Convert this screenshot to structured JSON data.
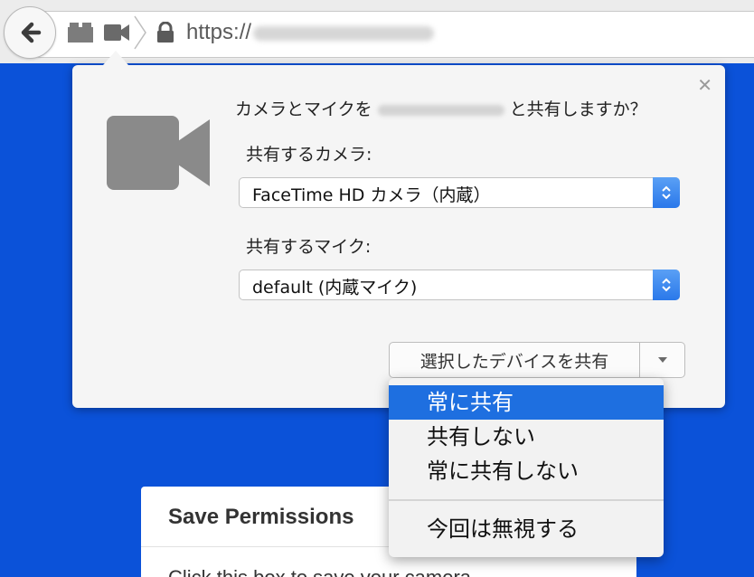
{
  "toolbar": {
    "url_prefix": "https://"
  },
  "popup": {
    "question_prefix": "カメラとマイクを",
    "question_suffix": "と共有しますか？",
    "camera_label": "共有するカメラ:",
    "camera_value": "FaceTime HD カメラ（内蔵）",
    "mic_label": "共有するマイク:",
    "mic_value": "default (内蔵マイク)",
    "share_button": "選択したデバイスを共有",
    "close_glyph": "✕"
  },
  "menu": {
    "items": [
      {
        "label": "常に共有"
      },
      {
        "label": "共有しない"
      },
      {
        "label": "常に共有しない"
      },
      {
        "label": "今回は無視する"
      }
    ]
  },
  "card": {
    "title": "Save Permissions",
    "description": "Click this box to save your camera"
  },
  "colors": {
    "page_background": "#0b52d9",
    "menu_highlight": "#1e6fe0",
    "stepper_blue": "#2a78ea"
  }
}
